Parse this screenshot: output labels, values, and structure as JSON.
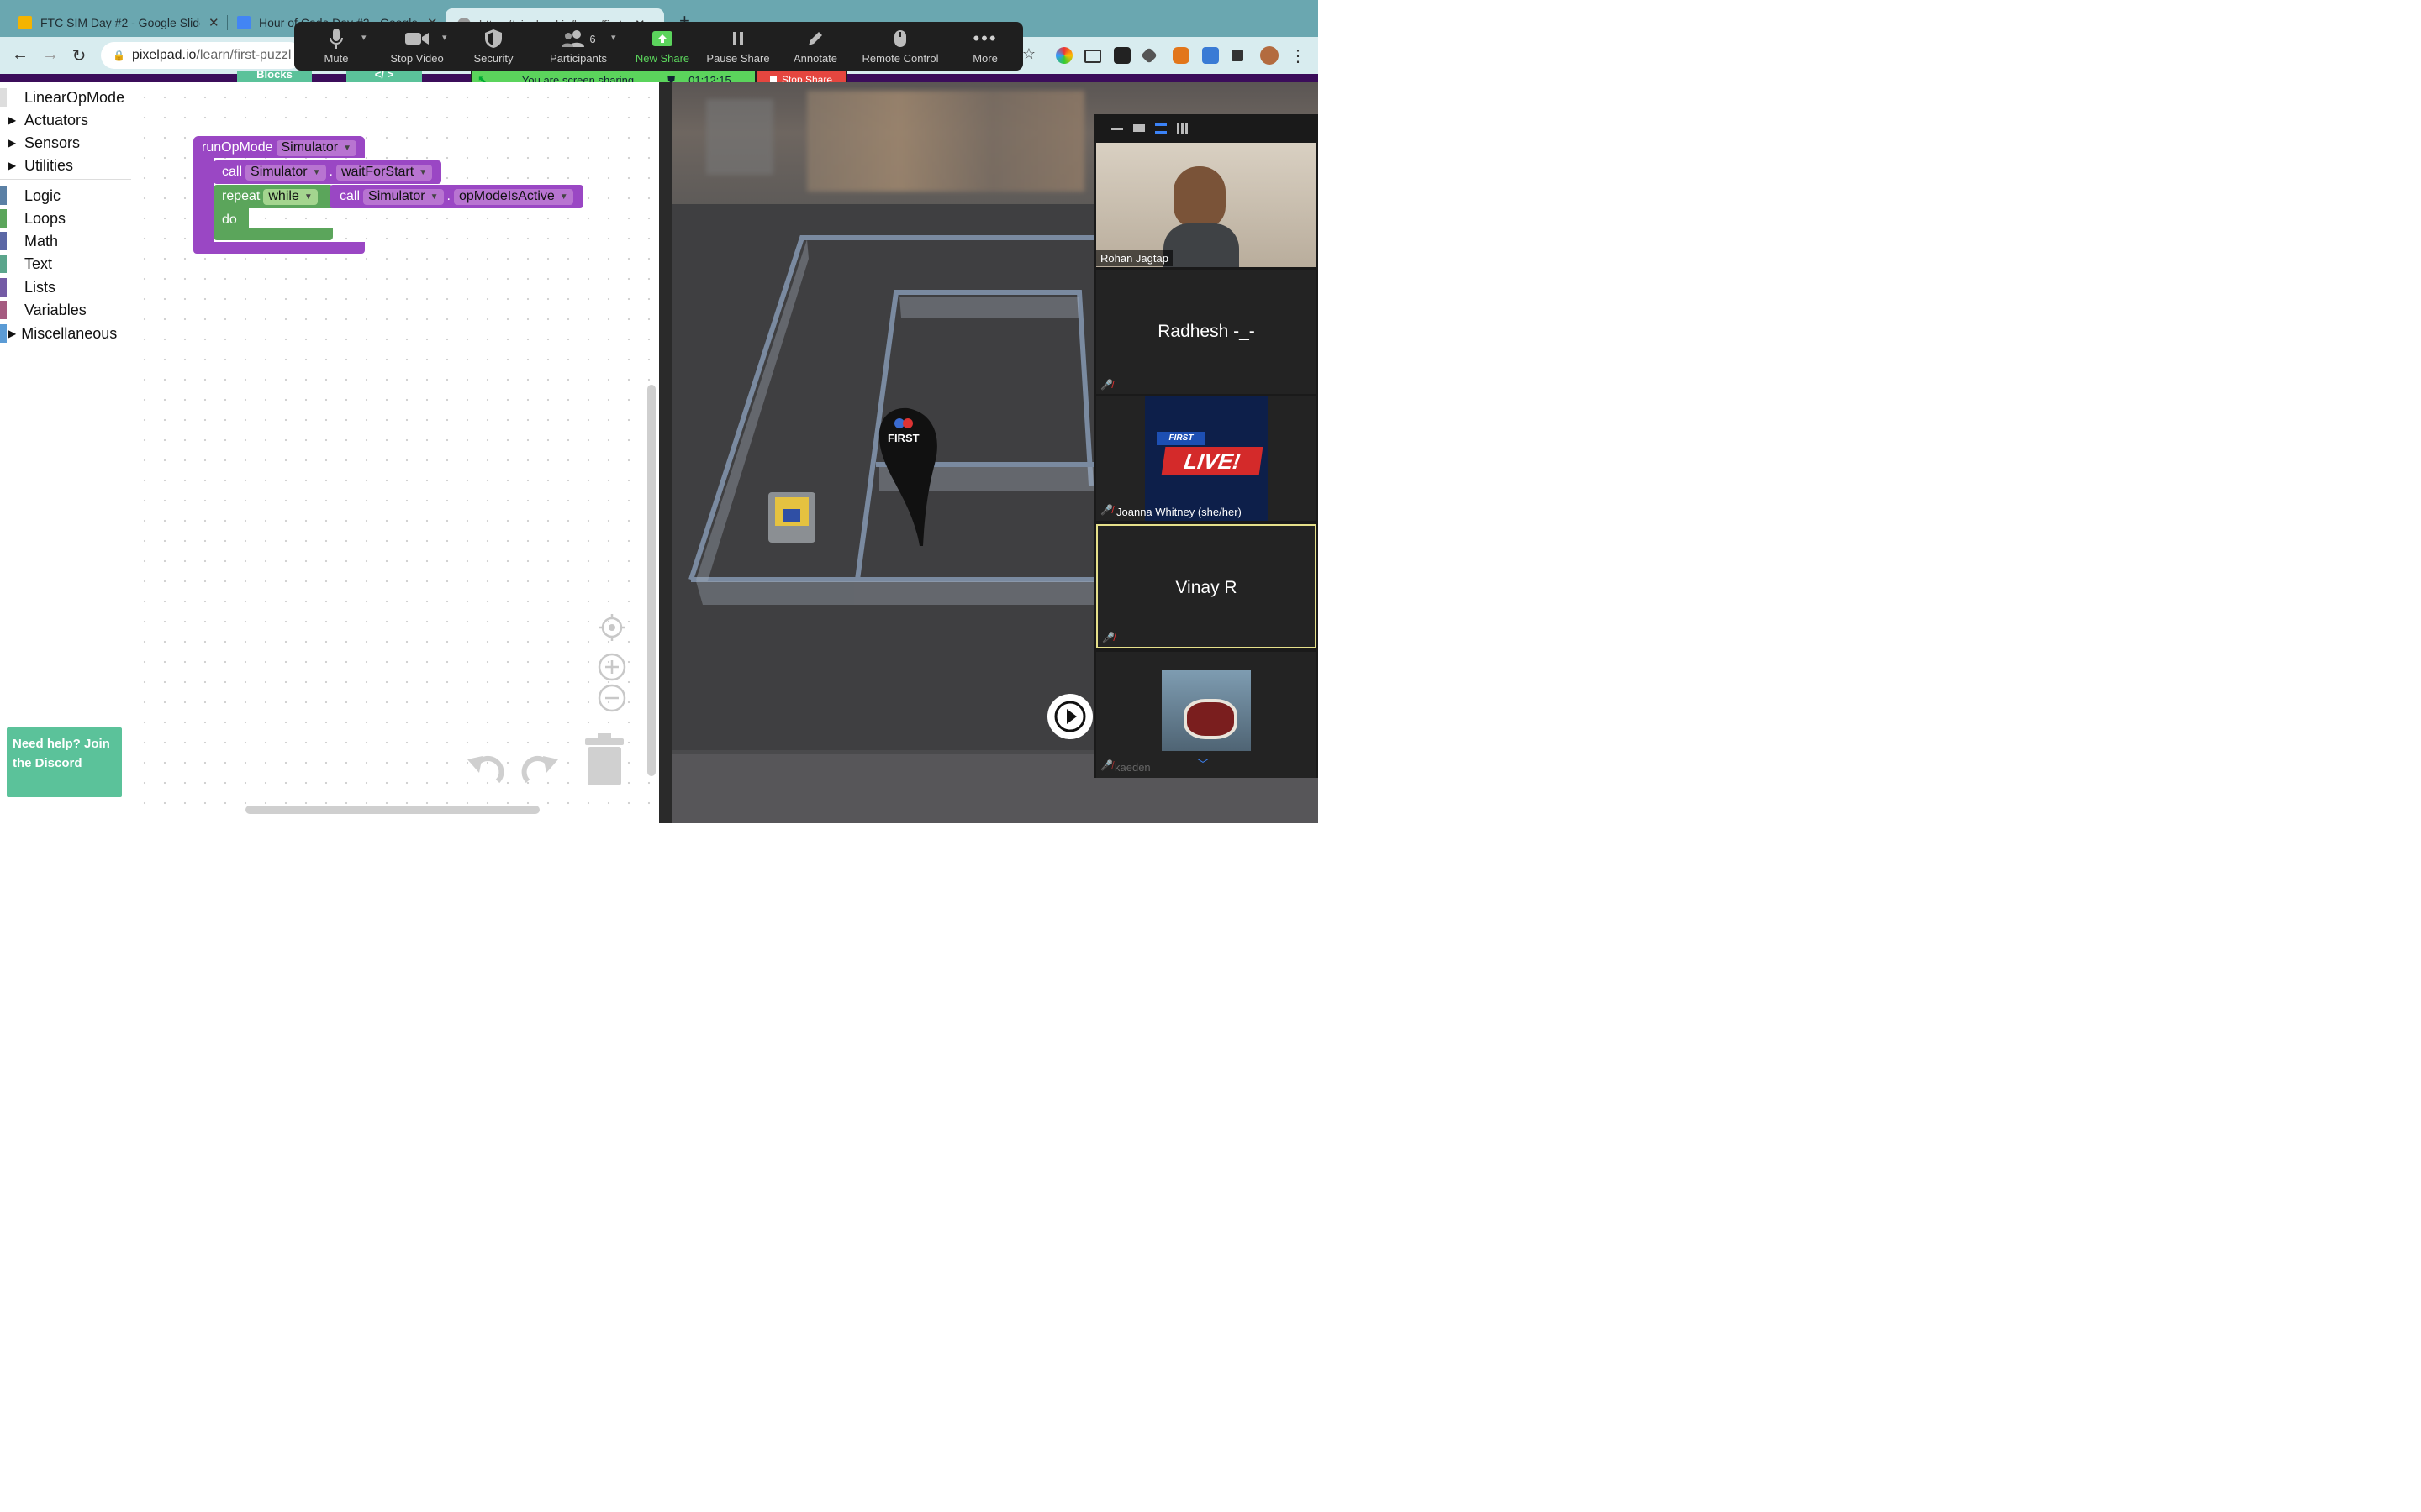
{
  "browser": {
    "tabs": [
      {
        "title": "FTC SIM Day #2 - Google Slide",
        "favicon_color": "#f4b400"
      },
      {
        "title": "Hour of Code Day #2 - Google",
        "favicon_color": "#4285f4"
      },
      {
        "title": "https://pixelpad.io/learn/first-"
      }
    ],
    "address": {
      "host": "pixelpad.io",
      "path": "/learn/first-puzzl"
    }
  },
  "zoom_toolbar": {
    "items": [
      {
        "id": "mute",
        "label": "Mute"
      },
      {
        "id": "stop-video",
        "label": "Stop Video"
      },
      {
        "id": "security",
        "label": "Security"
      },
      {
        "id": "participants",
        "label": "Participants",
        "count": "6"
      },
      {
        "id": "new-share",
        "label": "New Share"
      },
      {
        "id": "pause-share",
        "label": "Pause Share"
      },
      {
        "id": "annotate",
        "label": "Annotate"
      },
      {
        "id": "remote-control",
        "label": "Remote Control"
      },
      {
        "id": "more",
        "label": "More"
      }
    ],
    "sharing_status": "You are screen sharing",
    "timer": "01:12:15",
    "stop_share": "Stop Share",
    "accent": "#5bd45c"
  },
  "editor": {
    "mode_tabs": [
      "Blocks",
      "</ >"
    ],
    "toolbox": {
      "items": [
        {
          "label": "LinearOpMode",
          "expandable": false,
          "color": "#dddddd"
        },
        {
          "label": "Actuators",
          "expandable": true,
          "color": null
        },
        {
          "label": "Sensors",
          "expandable": true,
          "color": null
        },
        {
          "label": "Utilities",
          "expandable": true,
          "color": null
        },
        {
          "label": "Logic",
          "expandable": false,
          "color": "#5b80a5"
        },
        {
          "label": "Loops",
          "expandable": false,
          "color": "#5ba55b"
        },
        {
          "label": "Math",
          "expandable": false,
          "color": "#5b67a5"
        },
        {
          "label": "Text",
          "expandable": false,
          "color": "#5ba58c"
        },
        {
          "label": "Lists",
          "expandable": false,
          "color": "#745ba5"
        },
        {
          "label": "Variables",
          "expandable": false,
          "color": "#a55b80"
        },
        {
          "label": "Miscellaneous",
          "expandable": true,
          "color": "#5b9bd5"
        }
      ]
    },
    "help": "Need help? Join the Discord",
    "blocks": {
      "runopmode": {
        "keyword": "runOpMode",
        "arg": "Simulator"
      },
      "waitforstart": {
        "keyword": "call",
        "obj": "Simulator",
        "dot": ".",
        "method": "waitForStart"
      },
      "repeat": {
        "keyword": "repeat",
        "mode": "while",
        "do": "do"
      },
      "opmodeisactive": {
        "keyword": "call",
        "obj": "Simulator",
        "dot": ".",
        "method": "opModeIsActive"
      }
    }
  },
  "participants": [
    {
      "name": "Rohan Jagtap",
      "video": true
    },
    {
      "name": "Radhesh -_-",
      "video": false,
      "muted": true
    },
    {
      "name": "Joanna Whitney (she/her)",
      "video": true,
      "muted": true,
      "banner": "LIVE!",
      "banner_brand": "FIRST"
    },
    {
      "name": "Vinay R",
      "video": false,
      "muted": true,
      "active_speaker": true
    },
    {
      "name": "kaeden",
      "video": true,
      "muted": true
    }
  ],
  "simulator": {
    "flag_text": "FIRST"
  }
}
